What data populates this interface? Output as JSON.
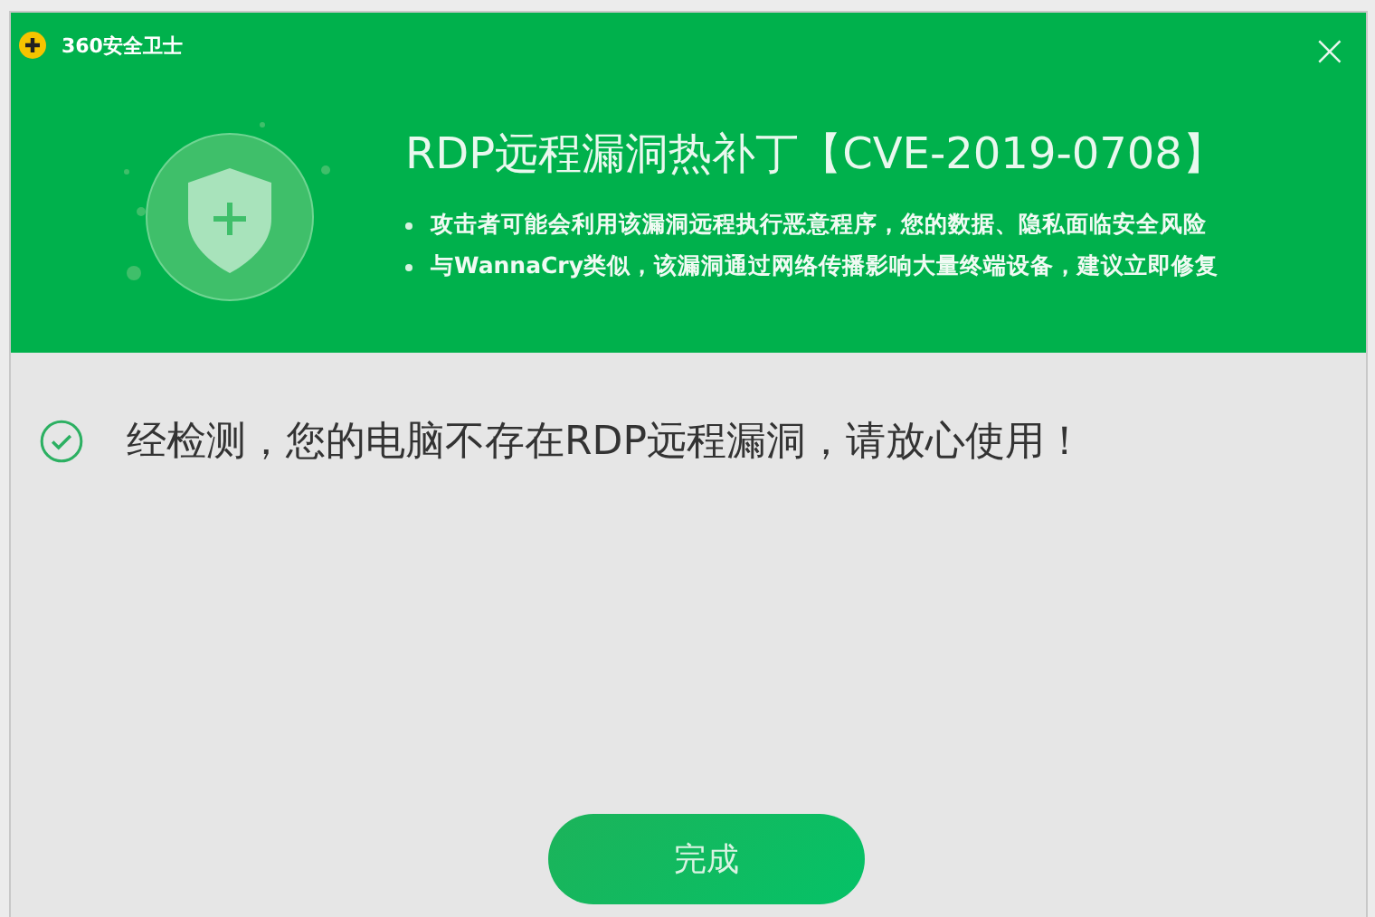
{
  "window": {
    "app_name": "360安全卫士",
    "close": "×"
  },
  "header": {
    "title": "RDP远程漏洞热补丁【CVE-2019-0708】",
    "bullets": [
      "攻击者可能会利用该漏洞远程执行恶意程序，您的数据、隐私面临安全风险",
      "与WannaCry类似，该漏洞通过网络传播影响大量终端设备，建议立即修复"
    ]
  },
  "result": {
    "vulnerable": false,
    "message": "经检测，您的电脑不存在RDP远程漏洞，请放心使用！"
  },
  "buttons": [
    "完成"
  ]
}
